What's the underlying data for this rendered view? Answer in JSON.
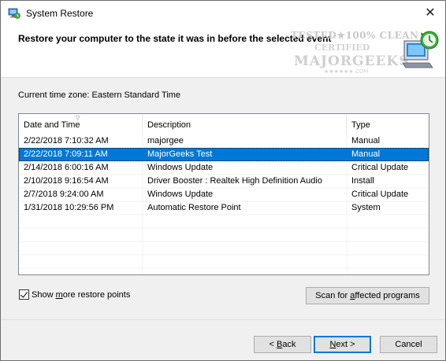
{
  "window": {
    "title": "System Restore",
    "icon": "system-restore-icon",
    "close_glyph": "✕"
  },
  "header": {
    "text": "Restore your computer to the state it was in before the selected event",
    "watermark": {
      "line1": "TESTED★100% CLEAN",
      "line2": "CERTIFIED",
      "line3": "MAJORGEEKS",
      "line4": "★★★★★★.COM"
    }
  },
  "timezone_label": "Current time zone: Eastern Standard Time",
  "list": {
    "columns": [
      {
        "label": "Date and Time"
      },
      {
        "label": "Description"
      },
      {
        "label": "Type"
      }
    ],
    "sort_indicator": "▽",
    "rows": [
      {
        "date": "2/22/2018 7:10:32 AM",
        "description": "majorgee",
        "type": "Manual",
        "selected": false
      },
      {
        "date": "2/22/2018 7:09:11 AM",
        "description": "MajorGeeks Test",
        "type": "Manual",
        "selected": true
      },
      {
        "date": "2/14/2018 6:00:16 AM",
        "description": "Windows Update",
        "type": "Critical Update",
        "selected": false
      },
      {
        "date": "2/10/2018 9:16:54 AM",
        "description": "Driver Booster : Realtek High Definition Audio",
        "type": "Install",
        "selected": false
      },
      {
        "date": "2/7/2018 9:24:00 AM",
        "description": "Windows Update",
        "type": "Critical Update",
        "selected": false
      },
      {
        "date": "1/31/2018 10:29:56 PM",
        "description": "Automatic Restore Point",
        "type": "System",
        "selected": false
      }
    ]
  },
  "show_more": {
    "label_before": "Show ",
    "label_accel": "m",
    "label_after": "ore restore points",
    "checked": true
  },
  "scan_button": {
    "label_before": "Scan for ",
    "label_accel": "a",
    "label_after": "ffected programs"
  },
  "footer": {
    "back_before": "< ",
    "back_accel": "B",
    "back_after": "ack",
    "next_before": "",
    "next_accel": "N",
    "next_after": "ext >",
    "cancel_label": "Cancel"
  },
  "colors": {
    "selection": "#0078d7",
    "default_button_border": "#0078d7"
  }
}
